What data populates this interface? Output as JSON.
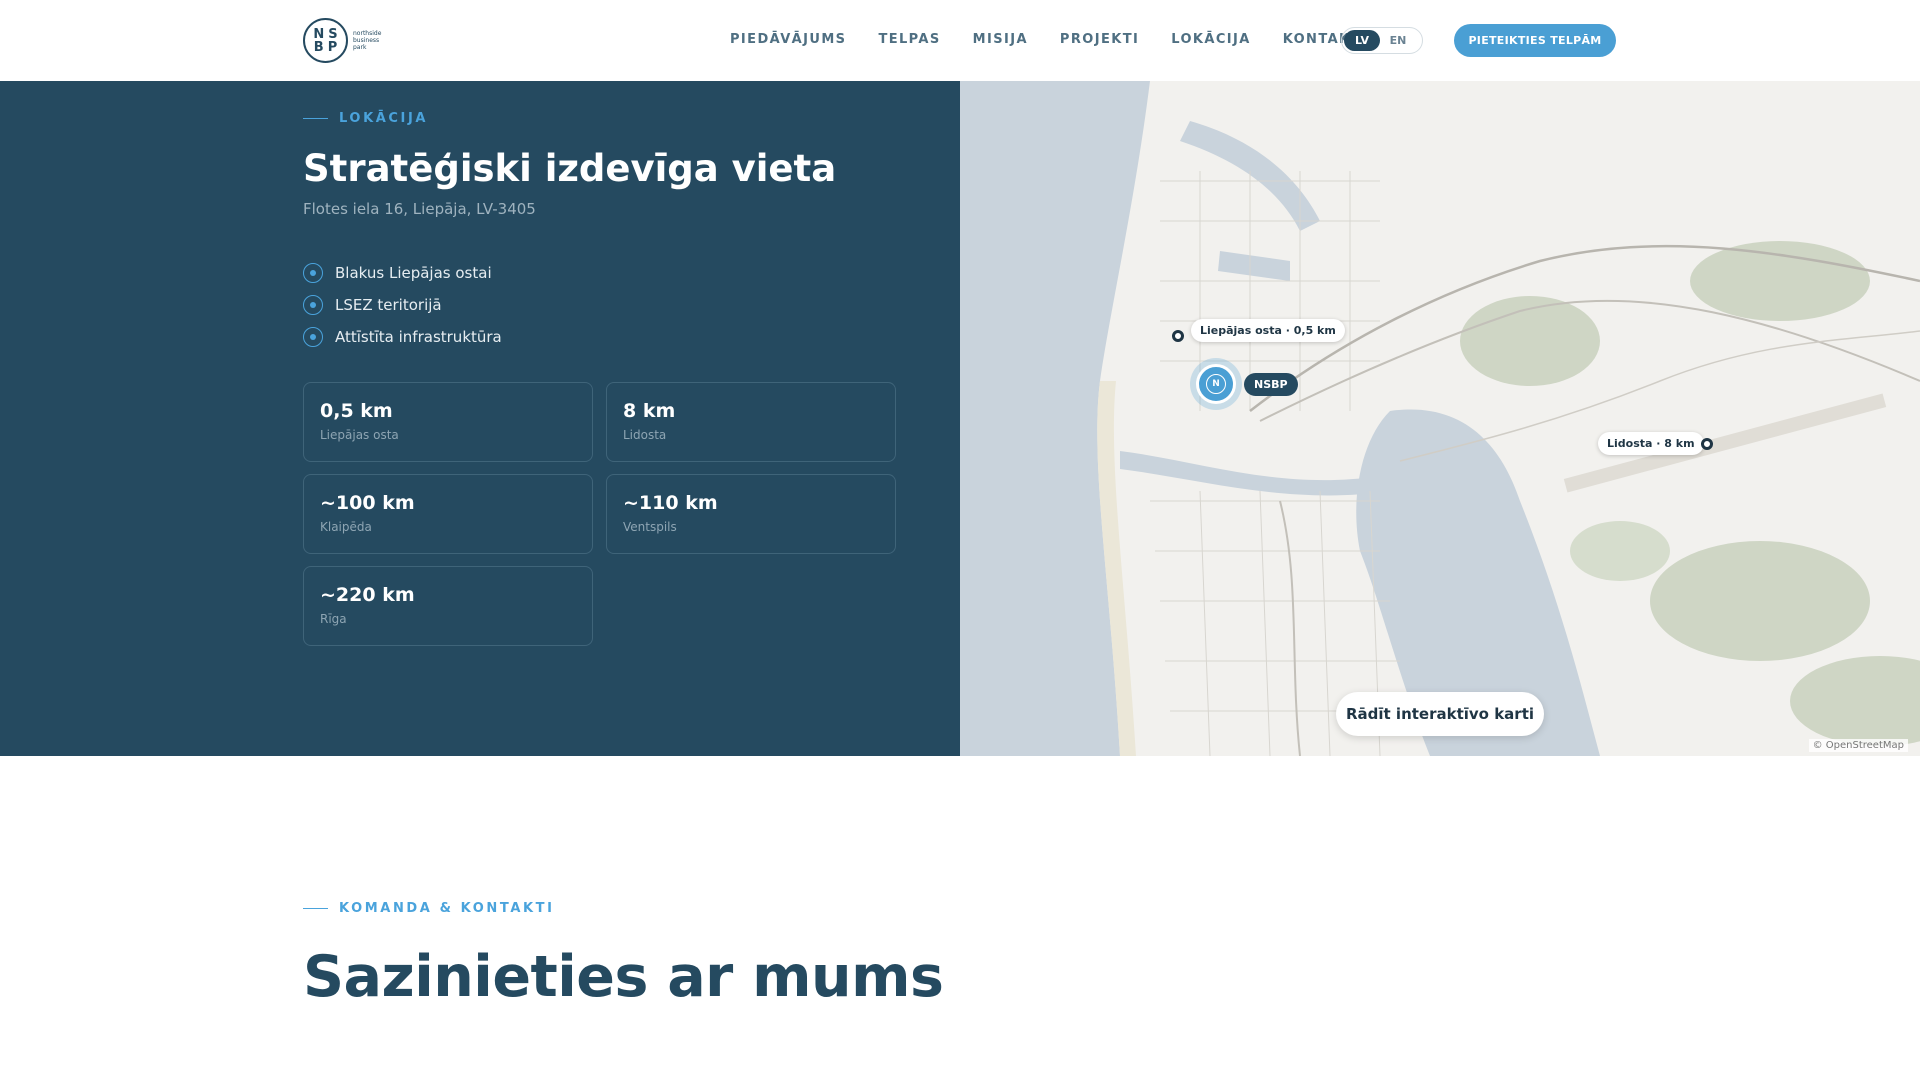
{
  "header": {
    "logo": {
      "monogram_top": "NS",
      "monogram_bottom": "BP",
      "text_lines": [
        "northside",
        "business",
        "park"
      ]
    },
    "nav": [
      "PIEDĀVĀJUMS",
      "TELPAS",
      "MISIJA",
      "PROJEKTI",
      "LOKĀCIJA",
      "KONTAKTI"
    ],
    "lang": {
      "active": "LV",
      "other": "EN"
    },
    "cta": "PIETEIKTIES TELPĀM"
  },
  "location": {
    "eyebrow": "LOKĀCIJA",
    "title": "Stratēģiski izdevīga vieta",
    "address": "Flotes iela 16, Liepāja, LV-3405",
    "features": [
      "Blakus Liepājas ostai",
      "LSEZ teritorijā",
      "Attīstīta infrastruktūra"
    ],
    "distances": [
      {
        "value": "0,5 km",
        "label": "Liepājas osta"
      },
      {
        "value": "8 km",
        "label": "Lidosta"
      },
      {
        "value": "~100 km",
        "label": "Klaipēda"
      },
      {
        "value": "~110 km",
        "label": "Ventspils"
      },
      {
        "value": "~220 km",
        "label": "Rīga"
      }
    ]
  },
  "map": {
    "port_label": "Liepājas osta · 0,5 km",
    "airport_label": "Lidosta · 8 km",
    "marker_label": "NSBP",
    "marker_icon": "N",
    "button": "Rādīt interaktīvo karti",
    "attribution": "© OpenStreetMap",
    "colors": {
      "water": "#c9d3dc",
      "land": "#f2f1ee",
      "forest": "#cfd6c5"
    }
  },
  "contact": {
    "eyebrow": "KOMANDA & KONTAKTI",
    "title": "Sazinieties ar mums"
  },
  "colors": {
    "primary": "#254a60",
    "accent": "#4a9fd4",
    "white": "#ffffff"
  }
}
